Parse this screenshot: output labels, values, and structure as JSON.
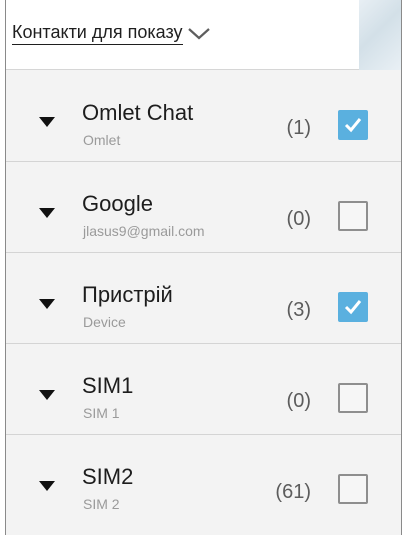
{
  "header": {
    "title": "Контакти для показу",
    "dropdown_icon": "chevron-down-icon"
  },
  "colors": {
    "checkbox_checked": "#5ab0df",
    "background": "#f3f3f3"
  },
  "accounts": [
    {
      "id": "omlet",
      "title": "Omlet Chat",
      "subtitle": "Omlet",
      "count": "(1)",
      "checked": true
    },
    {
      "id": "google",
      "title": "Google",
      "subtitle": "jlasus9@gmail.com",
      "count": "(0)",
      "checked": false
    },
    {
      "id": "device",
      "title": "Пристрій",
      "subtitle": "Device",
      "count": "(3)",
      "checked": true
    },
    {
      "id": "sim1",
      "title": "SIM1",
      "subtitle": "SIM 1",
      "count": "(0)",
      "checked": false
    },
    {
      "id": "sim2",
      "title": "SIM2",
      "subtitle": "SIM 2",
      "count": "(61)",
      "checked": false
    }
  ]
}
